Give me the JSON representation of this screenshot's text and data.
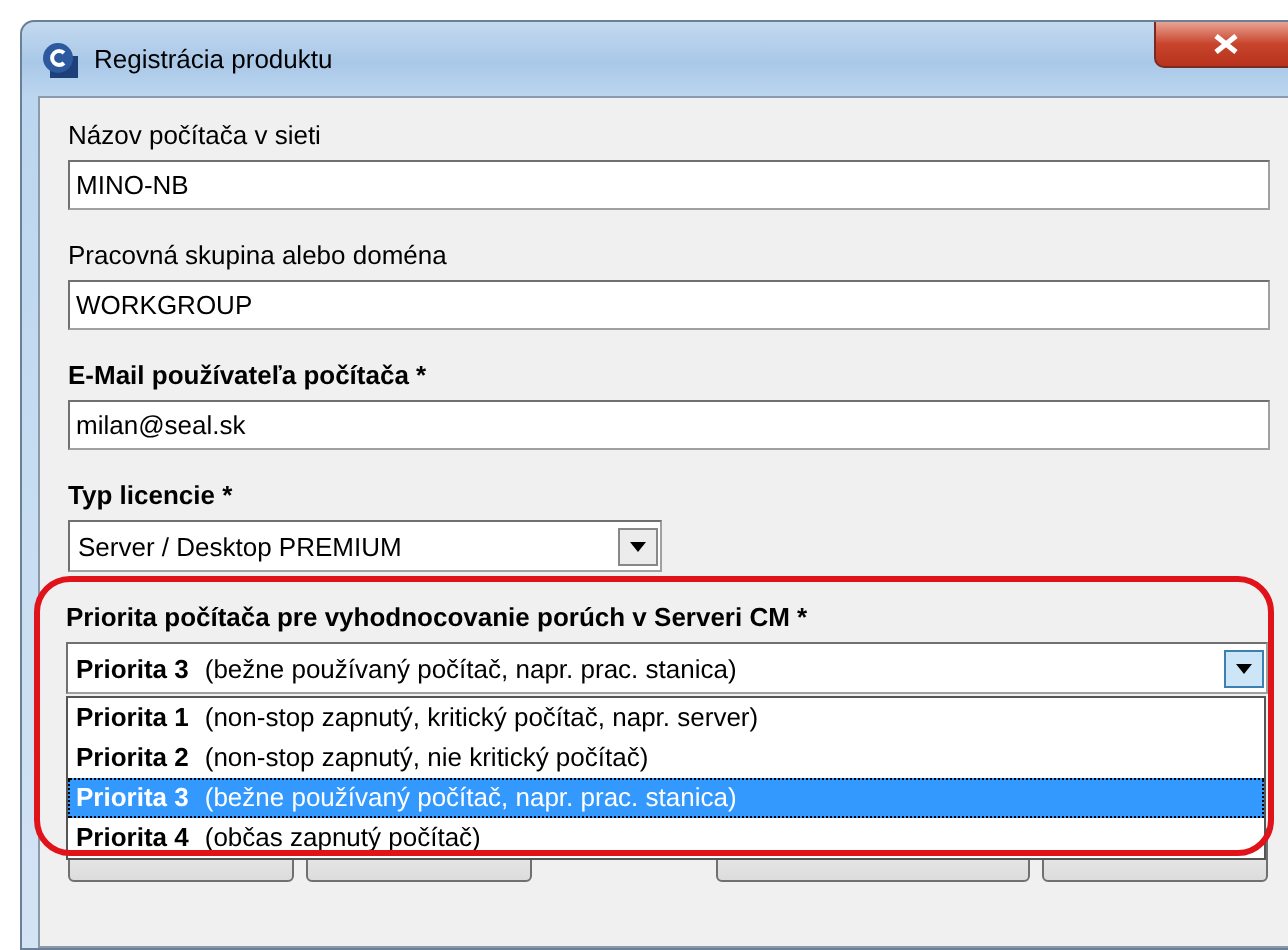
{
  "window": {
    "title": "Registrácia produktu"
  },
  "fields": [
    {
      "kind": "text",
      "label": "Názov počítača v sieti",
      "bold": false,
      "value": "MINO-NB"
    },
    {
      "kind": "text",
      "label": "Pracovná skupina alebo doména",
      "bold": false,
      "value": "WORKGROUP"
    },
    {
      "kind": "text",
      "label": "E-Mail používateľa počítača *",
      "bold": true,
      "value": "milan@seal.sk"
    },
    {
      "kind": "select",
      "label": "Typ licencie *",
      "bold": true,
      "value": "Server / Desktop PREMIUM"
    }
  ],
  "priority": {
    "label": "Priorita počítača pre vyhodnocovanie porúch v Serveri CM *",
    "highlighted": true,
    "expanded": true,
    "value": {
      "name": "Priorita 3",
      "note": "(bežne používaný počítač, napr. prac. stanica)"
    },
    "options": [
      {
        "name": "Priorita 1",
        "note": "(non-stop zapnutý, kritický počítač, napr. server)",
        "selected": false
      },
      {
        "name": "Priorita 2",
        "note": "(non-stop zapnutý, nie kritický počítač)",
        "selected": false
      },
      {
        "name": "Priorita 3",
        "note": "(bežne používaný počítač, napr. prac. stanica)",
        "selected": true
      },
      {
        "name": "Priorita 4",
        "note": "(občas zapnutý počítač)",
        "selected": false
      }
    ]
  }
}
